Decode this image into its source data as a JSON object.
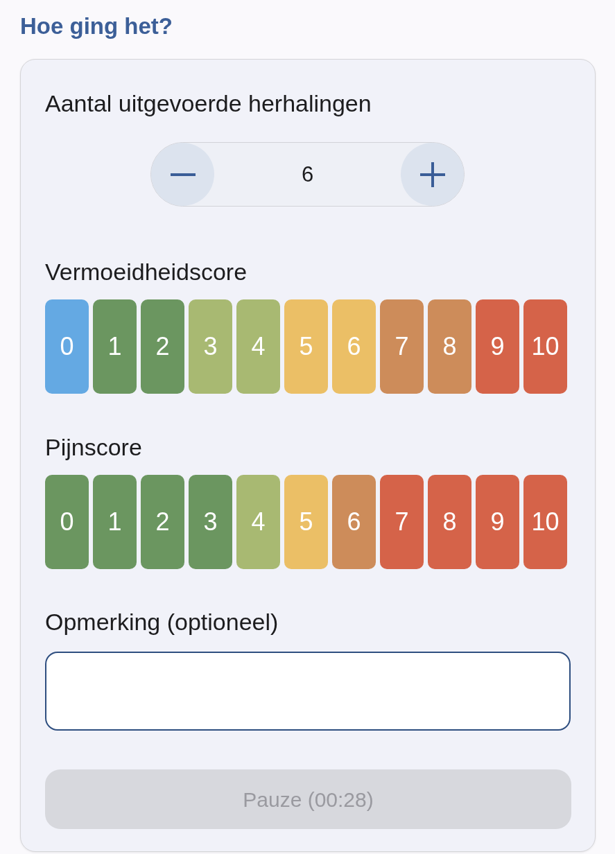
{
  "title": "Hoe ging het?",
  "repetitions": {
    "label": "Aantal uitgevoerde herhalingen",
    "value": "6"
  },
  "fatigue_score": {
    "label": "Vermoeidheidscore",
    "options": [
      {
        "label": "0",
        "selected": true
      },
      {
        "label": "1",
        "selected": false,
        "color": "#6b9660"
      },
      {
        "label": "2",
        "selected": false,
        "color": "#6b9660"
      },
      {
        "label": "3",
        "selected": false,
        "color": "#a8b972"
      },
      {
        "label": "4",
        "selected": false,
        "color": "#a8b972"
      },
      {
        "label": "5",
        "selected": false,
        "color": "#ebbf66"
      },
      {
        "label": "6",
        "selected": false,
        "color": "#ebbf66"
      },
      {
        "label": "7",
        "selected": false,
        "color": "#cd8c5a"
      },
      {
        "label": "8",
        "selected": false,
        "color": "#cd8c5a"
      },
      {
        "label": "9",
        "selected": false,
        "color": "#d56349"
      },
      {
        "label": "10",
        "selected": false,
        "color": "#d56349"
      }
    ]
  },
  "pain_score": {
    "label": "Pijnscore",
    "options": [
      {
        "label": "0",
        "selected": false,
        "color": "#6b9660"
      },
      {
        "label": "1",
        "selected": false,
        "color": "#6b9660"
      },
      {
        "label": "2",
        "selected": false,
        "color": "#6b9660"
      },
      {
        "label": "3",
        "selected": false,
        "color": "#6b9660"
      },
      {
        "label": "4",
        "selected": false,
        "color": "#a8b972"
      },
      {
        "label": "5",
        "selected": false,
        "color": "#ebbf66"
      },
      {
        "label": "6",
        "selected": false,
        "color": "#cd8c5a"
      },
      {
        "label": "7",
        "selected": false,
        "color": "#d56349"
      },
      {
        "label": "8",
        "selected": false,
        "color": "#d56349"
      },
      {
        "label": "9",
        "selected": false,
        "color": "#d56349"
      },
      {
        "label": "10",
        "selected": false,
        "color": "#d56349"
      }
    ]
  },
  "remark": {
    "label": "Opmerking (optioneel)"
  },
  "pause_button": {
    "label": "Pauze (00:28)",
    "disabled": true
  }
}
